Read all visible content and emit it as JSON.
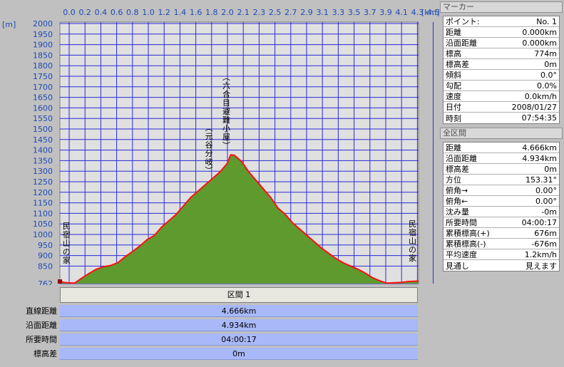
{
  "chart_data": {
    "type": "area",
    "x_unit": "[km]",
    "y_unit": "[m]",
    "x_ticks": [
      "0.0",
      "0.2",
      "0.4",
      "0.6",
      "0.8",
      "1.0",
      "1.2",
      "1.4",
      "1.6",
      "1.8",
      "2.0",
      "2.1",
      "2.3",
      "2.5",
      "2.7",
      "2.9",
      "3.1",
      "3.3",
      "3.5",
      "3.7",
      "3.9",
      "4.1",
      "4.3",
      "4.5"
    ],
    "xlim": [
      0,
      4.934
    ],
    "y_ticks": [
      "2000",
      "1950",
      "1900",
      "1850",
      "1800",
      "1750",
      "1700",
      "1650",
      "1600",
      "1550",
      "1500",
      "1450",
      "1400",
      "1350",
      "1300",
      "1250",
      "1200",
      "1150",
      "1100",
      "1050",
      "1000",
      "950",
      "900",
      "850",
      "762"
    ],
    "ylim": [
      762,
      2000
    ],
    "series": [
      {
        "x": [
          0,
          0.05,
          0.1,
          0.2,
          0.3,
          0.4,
          0.5,
          0.6,
          0.7,
          0.8,
          0.9,
          1.0,
          1.1,
          1.2,
          1.3,
          1.4,
          1.5,
          1.6,
          1.7,
          1.8,
          1.9,
          2.0,
          2.1,
          2.2,
          2.3,
          2.35,
          2.4,
          2.5,
          2.6,
          2.7,
          2.8,
          2.9,
          3.0,
          3.1,
          3.2,
          3.3,
          3.4,
          3.5,
          3.6,
          3.7,
          3.8,
          3.9,
          4.0,
          4.1,
          4.2,
          4.3,
          4.4,
          4.5,
          4.6,
          4.7,
          4.8,
          4.934
        ],
        "y": [
          774,
          768,
          766,
          764,
          788,
          810,
          830,
          842,
          848,
          862,
          890,
          914,
          940,
          970,
          990,
          1030,
          1060,
          1090,
          1130,
          1170,
          1200,
          1230,
          1260,
          1290,
          1330,
          1372,
          1370,
          1340,
          1290,
          1250,
          1210,
          1170,
          1120,
          1090,
          1050,
          1020,
          990,
          960,
          930,
          905,
          880,
          860,
          845,
          830,
          812,
          790,
          775,
          764,
          766,
          768,
          772,
          774
        ]
      }
    ],
    "annotations": [
      {
        "text": "民宿山の家",
        "x": 0.1
      },
      {
        "text": "(元谷分岐)",
        "x": 2.06
      },
      {
        "text": "(六合目避難小屋)",
        "x": 2.3
      },
      {
        "text": "民宿山の家",
        "x": 4.86
      }
    ],
    "colors": {
      "plot_bg": "#e0e0e0",
      "grid": "#2a2ad8",
      "fill": "#5e9a2e",
      "line": "#ff1010",
      "axis_text": "#1f49b5"
    }
  },
  "section_header": "区間 1",
  "summary": [
    {
      "label": "直線距離",
      "value": "4.666km"
    },
    {
      "label": "沿面距離",
      "value": "4.934km"
    },
    {
      "label": "所要時間",
      "value": "04:00:17"
    },
    {
      "label": "標高差",
      "value": "0m"
    }
  ],
  "marker": {
    "title": "マーカー",
    "rows": [
      {
        "label": "ポイント:",
        "value": "No. 1"
      },
      {
        "label": "距離",
        "value": "0.000km"
      },
      {
        "label": "沿面距離",
        "value": "0.000km"
      },
      {
        "label": "標高",
        "value": "774m"
      },
      {
        "label": "標高差",
        "value": "0m"
      },
      {
        "label": "傾斜",
        "value": "0.0°"
      },
      {
        "label": "勾配",
        "value": "0.0%"
      },
      {
        "label": "速度",
        "value": "0.0km/h"
      },
      {
        "label": "日付",
        "value": "2008/01/27"
      },
      {
        "label": "時刻",
        "value": "07:54:35"
      }
    ]
  },
  "all_sections": {
    "title": "全区間",
    "rows": [
      {
        "label": "距離",
        "value": "4.666km"
      },
      {
        "label": "沿面距離",
        "value": "4.934km"
      },
      {
        "label": "標高差",
        "value": "0m"
      },
      {
        "label": "方位",
        "value": "153.31°"
      },
      {
        "label": "俯角→",
        "value": "0.00°"
      },
      {
        "label": "俯角←",
        "value": "0.00°"
      },
      {
        "label": "沈み量",
        "value": "-0m"
      },
      {
        "label": "所要時間",
        "value": "04:00:17"
      },
      {
        "label": "累積標高(+)",
        "value": "676m"
      },
      {
        "label": "累積標高(-)",
        "value": "-676m"
      },
      {
        "label": "平均速度",
        "value": "1.2km/h"
      },
      {
        "label": "見通し",
        "value": "見えます"
      }
    ]
  }
}
